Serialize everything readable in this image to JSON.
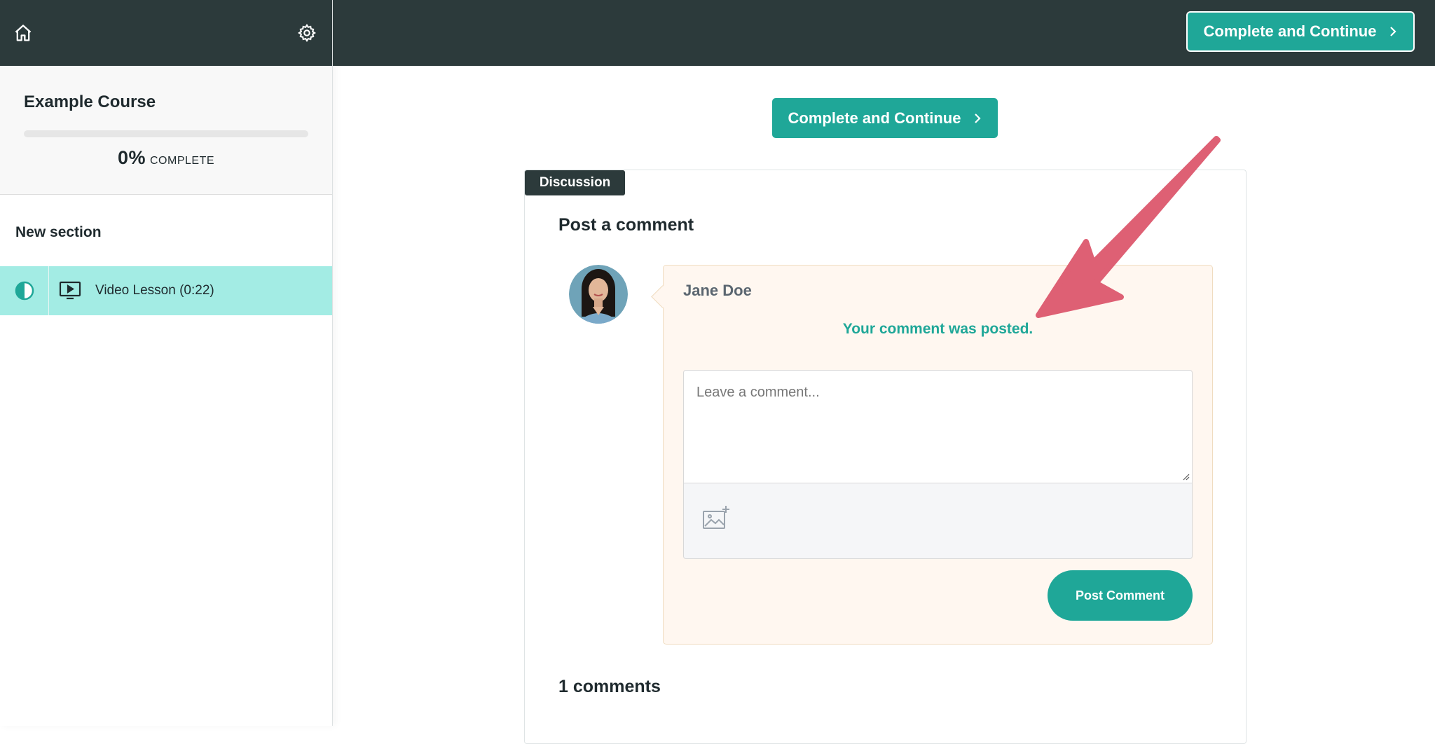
{
  "sidebar": {
    "home_icon": "home-icon",
    "settings_icon": "gear-icon",
    "course_title": "Example Course",
    "progress": {
      "percent_label": "0%",
      "suffix": "COMPLETE",
      "fraction": 0.0
    },
    "section_title": "New section",
    "lessons": [
      {
        "label": "Video Lesson (0:22)",
        "status_icon": "half-circle-icon",
        "type_icon": "video-icon",
        "active": true
      }
    ]
  },
  "topbar": {
    "cta_label": "Complete and Continue",
    "cta_icon": "chevron-right-icon"
  },
  "main": {
    "cta_label": "Complete and Continue",
    "discussion_tag": "Discussion",
    "post_heading": "Post a comment",
    "author_name": "Jane Doe",
    "posted_message": "Your comment was posted.",
    "comment_placeholder": "Leave a comment...",
    "attach_icon": "add-image-icon",
    "post_button": "Post Comment",
    "comments_count": "1 comments"
  },
  "colors": {
    "accent": "#1fa798",
    "dark": "#2c3a3b",
    "active_lesson": "#a3ece4",
    "annotation": "#de6074"
  }
}
